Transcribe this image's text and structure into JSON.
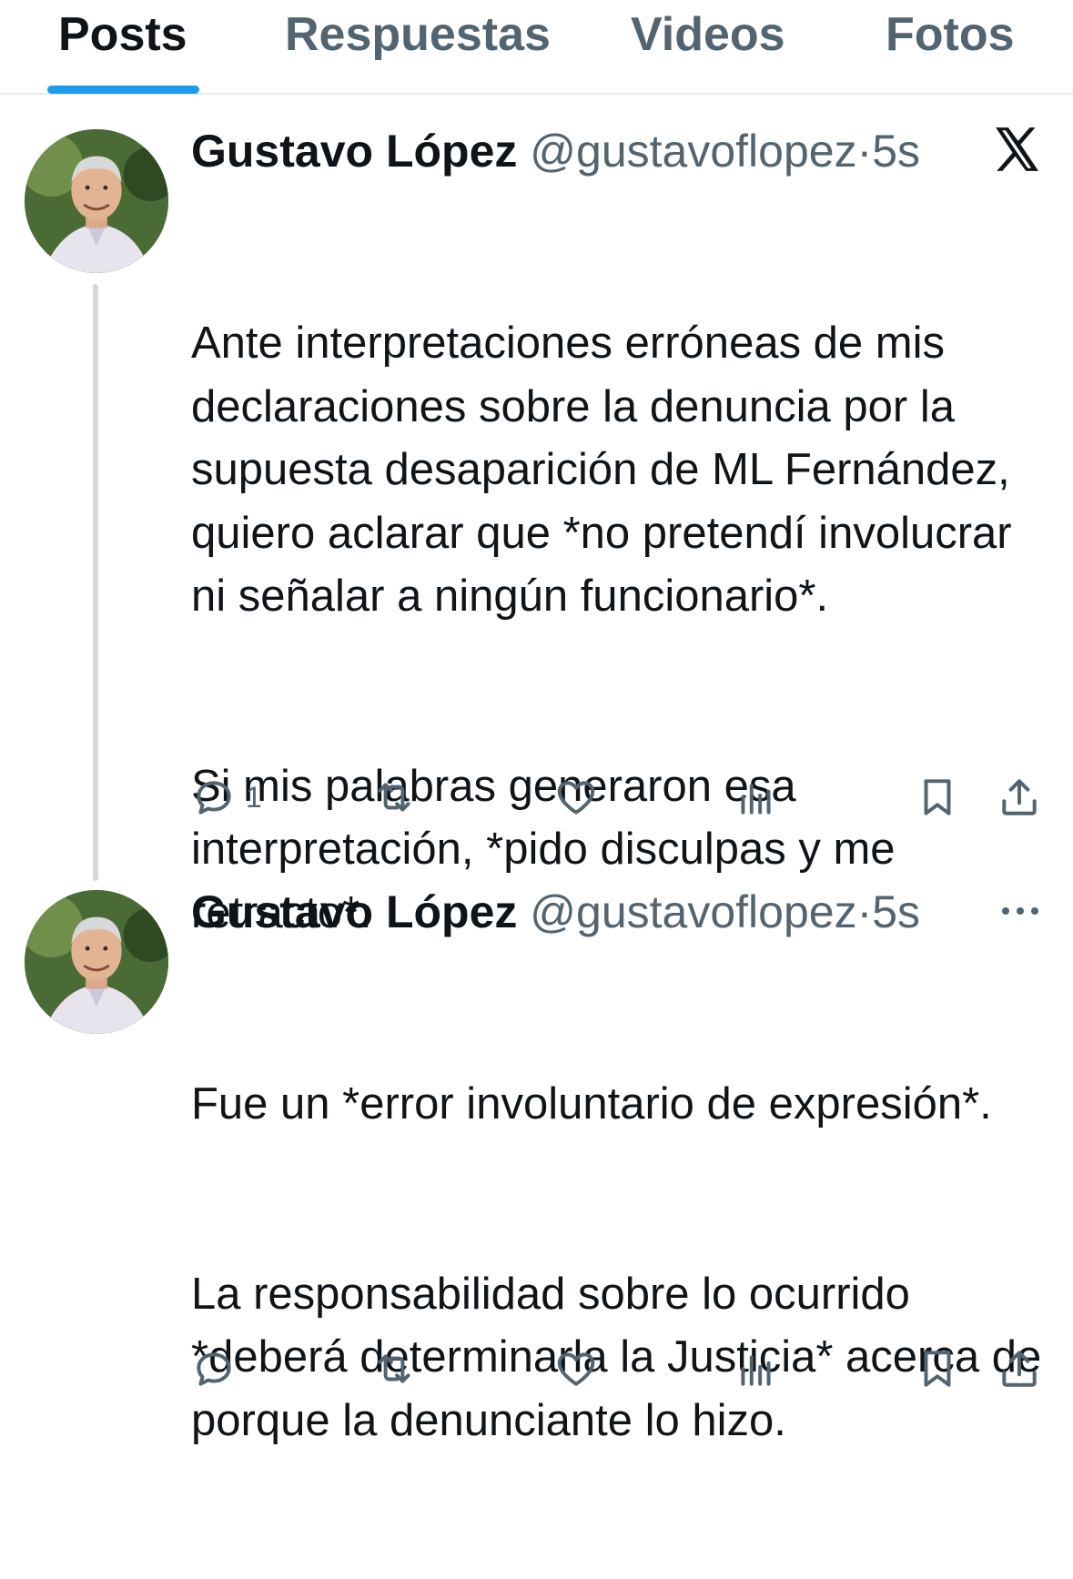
{
  "tabs": [
    {
      "label": "Posts",
      "active": true
    },
    {
      "label": "Respuestas",
      "active": false
    },
    {
      "label": "Videos",
      "active": false
    },
    {
      "label": "Fotos",
      "active": false
    }
  ],
  "accent_color": "#1d9bf0",
  "posts": [
    {
      "display_name": "Gustavo López",
      "handle": "@gustavoflopez",
      "separator": "·",
      "time": "5s",
      "corner_icon": "x-logo-icon",
      "paragraphs": [
        "Ante interpretaciones erróneas de mis declaraciones sobre la denuncia por la supuesta desaparición de ML Fernández, quiero aclarar que *no pretendí involucrar ni señalar a ningún funcionario*.",
        "Si mis palabras generaron esa interpretación, *pido disculpas y me retracto*."
      ],
      "reply_count": "1"
    },
    {
      "display_name": "Gustavo López",
      "handle": "@gustavoflopez",
      "separator": "·",
      "time": "5s",
      "corner_icon": "more-options-icon",
      "paragraphs": [
        "Fue un *error involuntario de expresión*.",
        "La responsabilidad sobre lo ocurrido *deberá determinarla la Justicia* acerca de porque la denunciante lo hizo."
      ],
      "reply_count": ""
    }
  ]
}
